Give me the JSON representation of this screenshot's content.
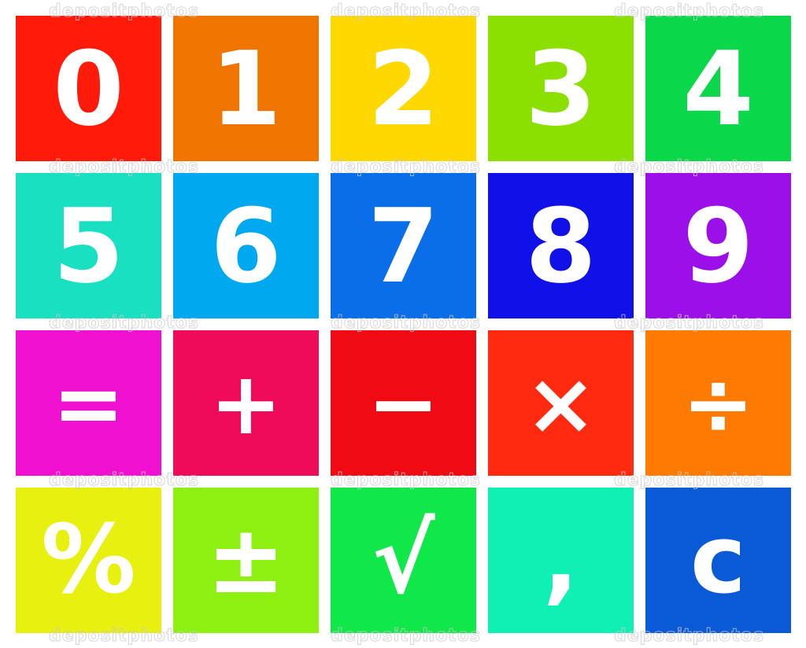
{
  "watermark": "depositphotos",
  "tiles": [
    {
      "label": "0",
      "color": "#ff1a0a"
    },
    {
      "label": "1",
      "color": "#f07500"
    },
    {
      "label": "2",
      "color": "#ffd800"
    },
    {
      "label": "3",
      "color": "#8ce000"
    },
    {
      "label": "4",
      "color": "#0ad84a"
    },
    {
      "label": "5",
      "color": "#18e0c0"
    },
    {
      "label": "6",
      "color": "#00a8f0"
    },
    {
      "label": "7",
      "color": "#0a6ee8"
    },
    {
      "label": "8",
      "color": "#1010e8"
    },
    {
      "label": "9",
      "color": "#9b10e8"
    },
    {
      "label": "=",
      "color": "#f010d0"
    },
    {
      "label": "+",
      "color": "#f00a5a"
    },
    {
      "label": "−",
      "color": "#f00a14"
    },
    {
      "label": "×",
      "color": "#ff2a10"
    },
    {
      "label": "÷",
      "color": "#ff7a00"
    },
    {
      "label": "%",
      "color": "#e8f010"
    },
    {
      "label": "±",
      "color": "#8ef010"
    },
    {
      "label": "√",
      "color": "#10e84a"
    },
    {
      "label": ",",
      "color": "#10f0b4"
    },
    {
      "label": "c",
      "color": "#0a5ad8"
    }
  ]
}
